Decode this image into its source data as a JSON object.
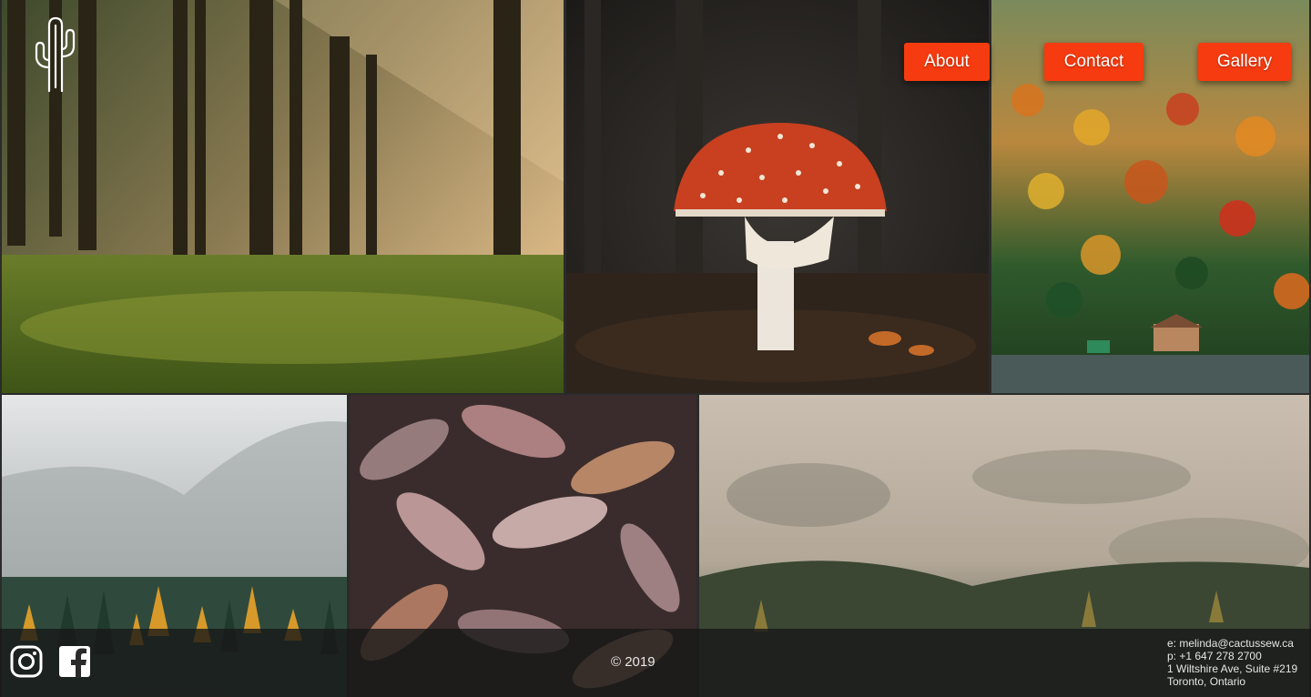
{
  "logo": {
    "icon": "cactus-icon"
  },
  "nav": {
    "about_label": "About",
    "contact_label": "Contact",
    "gallery_label": "Gallery"
  },
  "gallery": {
    "tiles": [
      {
        "subject": "sunlit-pine-forest"
      },
      {
        "subject": "red-mushroom"
      },
      {
        "subject": "autumn-hillside-lake"
      },
      {
        "subject": "foggy-pine-valley"
      },
      {
        "subject": "fallen-leaves"
      },
      {
        "subject": "misty-forest-aerial"
      }
    ]
  },
  "footer": {
    "social": [
      {
        "icon": "instagram-icon"
      },
      {
        "icon": "facebook-icon"
      }
    ],
    "copyright": "© 2019",
    "contact": {
      "email": "e: melinda@cactussew.ca",
      "phone": "p: +1 647 278 2700",
      "address_line1": "1 Wiltshire Ave, Suite #219",
      "address_line2": "Toronto, Ontario"
    }
  },
  "colors": {
    "accent": "#f53b0f",
    "footer_bg": "#181818",
    "footer_text": "#e6e6e6"
  }
}
